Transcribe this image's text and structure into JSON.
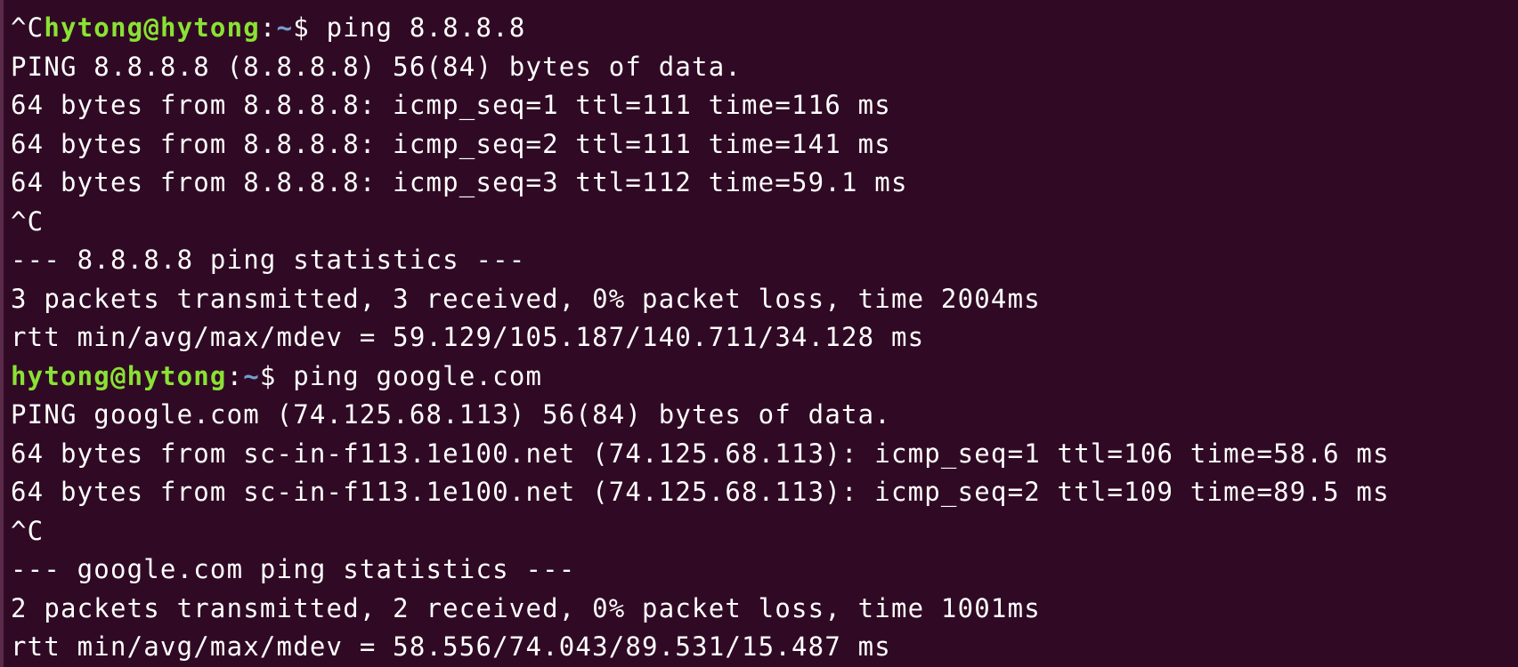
{
  "colors": {
    "background": "#300a24",
    "text": "#ffffff",
    "prompt_user": "#8ae234",
    "prompt_path": "#729fcf"
  },
  "cut_line": "",
  "lines": [
    {
      "kind": "prompt",
      "prefix": "^C",
      "user": "hytong@hytong",
      "colon": ":",
      "path": "~",
      "symbol": "$ ",
      "command": "ping 8.8.8.8"
    },
    {
      "kind": "text",
      "text": "PING 8.8.8.8 (8.8.8.8) 56(84) bytes of data."
    },
    {
      "kind": "text",
      "text": "64 bytes from 8.8.8.8: icmp_seq=1 ttl=111 time=116 ms"
    },
    {
      "kind": "text",
      "text": "64 bytes from 8.8.8.8: icmp_seq=2 ttl=111 time=141 ms"
    },
    {
      "kind": "text",
      "text": "64 bytes from 8.8.8.8: icmp_seq=3 ttl=112 time=59.1 ms"
    },
    {
      "kind": "text",
      "text": "^C"
    },
    {
      "kind": "text",
      "text": "--- 8.8.8.8 ping statistics ---"
    },
    {
      "kind": "text",
      "text": "3 packets transmitted, 3 received, 0% packet loss, time 2004ms"
    },
    {
      "kind": "text",
      "text": "rtt min/avg/max/mdev = 59.129/105.187/140.711/34.128 ms"
    },
    {
      "kind": "prompt",
      "prefix": "",
      "user": "hytong@hytong",
      "colon": ":",
      "path": "~",
      "symbol": "$ ",
      "command": "ping google.com"
    },
    {
      "kind": "text",
      "text": "PING google.com (74.125.68.113) 56(84) bytes of data."
    },
    {
      "kind": "text",
      "text": "64 bytes from sc-in-f113.1e100.net (74.125.68.113): icmp_seq=1 ttl=106 time=58.6 ms"
    },
    {
      "kind": "text",
      "text": "64 bytes from sc-in-f113.1e100.net (74.125.68.113): icmp_seq=2 ttl=109 time=89.5 ms"
    },
    {
      "kind": "text",
      "text": "^C"
    },
    {
      "kind": "text",
      "text": "--- google.com ping statistics ---"
    },
    {
      "kind": "text",
      "text": "2 packets transmitted, 2 received, 0% packet loss, time 1001ms"
    },
    {
      "kind": "text",
      "text": "rtt min/avg/max/mdev = 58.556/74.043/89.531/15.487 ms"
    }
  ]
}
